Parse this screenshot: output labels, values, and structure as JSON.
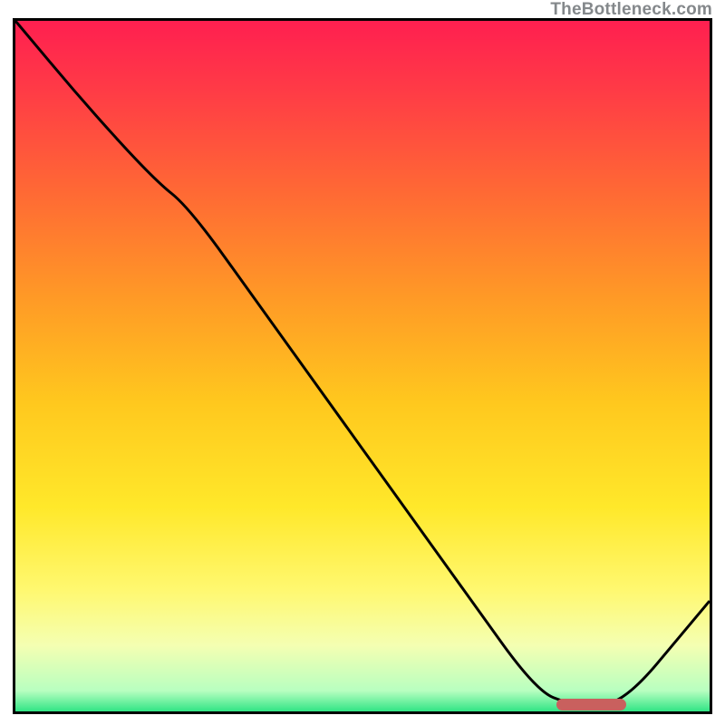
{
  "watermark": "TheBottleneck.com",
  "chart_data": {
    "type": "line",
    "title": "",
    "xlabel": "",
    "ylabel": "",
    "xlim": [
      0,
      100
    ],
    "ylim": [
      0,
      100
    ],
    "grid": false,
    "series": [
      {
        "name": "curve",
        "x": [
          0,
          10,
          20,
          25,
          35,
          45,
          55,
          65,
          75,
          80,
          83,
          86,
          90,
          95,
          100
        ],
        "y": [
          100,
          88,
          77,
          73,
          59,
          45,
          31,
          17,
          3,
          1,
          1,
          1,
          4,
          10,
          16
        ]
      }
    ],
    "marker": {
      "x_start": 78,
      "x_end": 88,
      "y": 1,
      "color": "#c9605e"
    },
    "gradient_stops": [
      {
        "pos": 0.0,
        "color": "#ff1f50"
      },
      {
        "pos": 0.1,
        "color": "#ff3b46"
      },
      {
        "pos": 0.25,
        "color": "#ff6a34"
      },
      {
        "pos": 0.4,
        "color": "#ff9a26"
      },
      {
        "pos": 0.55,
        "color": "#ffc81e"
      },
      {
        "pos": 0.7,
        "color": "#ffe82a"
      },
      {
        "pos": 0.82,
        "color": "#fff870"
      },
      {
        "pos": 0.9,
        "color": "#f4ffb2"
      },
      {
        "pos": 0.965,
        "color": "#b8ffc0"
      },
      {
        "pos": 1.0,
        "color": "#18e07a"
      }
    ]
  }
}
